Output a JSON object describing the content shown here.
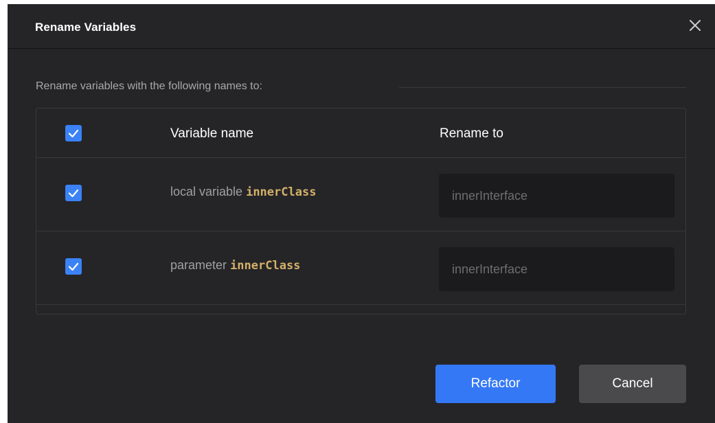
{
  "dialog": {
    "title": "Rename Variables",
    "close_icon": "close-icon",
    "section_label": "Rename variables with the following names to:",
    "table": {
      "headers": {
        "variable_name": "Variable name",
        "rename_to": "Rename to"
      },
      "select_all_checked": true,
      "rows": [
        {
          "checked": true,
          "kind": "local variable",
          "identifier": "innerClass",
          "rename_value": "innerInterface"
        },
        {
          "checked": true,
          "kind": "parameter",
          "identifier": "innerClass",
          "rename_value": "innerInterface"
        }
      ]
    },
    "buttons": {
      "refactor_label": "Refactor",
      "cancel_label": "Cancel"
    },
    "colors": {
      "background": "#252527",
      "accent": "#3478f6",
      "identifier": "#d4b06a"
    }
  }
}
